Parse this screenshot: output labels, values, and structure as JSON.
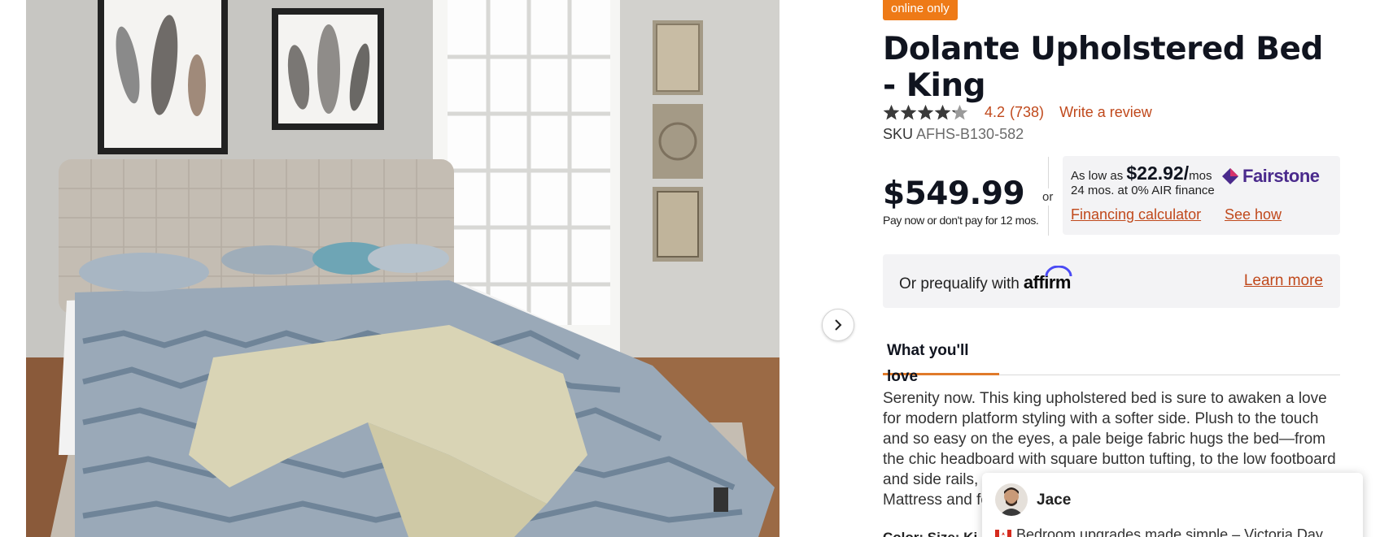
{
  "product": {
    "badge": "online only",
    "title": "Dolante Upholstered Bed - King",
    "rating_value": 4.2,
    "rating_label": "4.2",
    "rating_count": "(738)",
    "write_review": "Write a review",
    "sku_label": "SKU",
    "sku_value": "AFHS-B130-582",
    "image_alt": "Dolante Upholstered Bed - King"
  },
  "pricing": {
    "price": "$549.99",
    "pay_later": "Pay now or don't pay for 12 mos.",
    "or": "or",
    "as_low_as": "As low as",
    "monthly_amount": "$22.92/",
    "mos": "mos",
    "finance_terms": "24 mos. at 0% AIR finance",
    "fairstone_brand": "Fairstone",
    "financing_calculator": "Financing calculator",
    "see_how": "See how"
  },
  "affirm": {
    "prefix": "Or prequalify with",
    "brand": "affirm",
    "learn_more": "Learn more"
  },
  "tabs": [
    {
      "label": "What you'll love",
      "active": true
    }
  ],
  "description": "Serenity now. This king upholstered bed is sure to awaken a love for modern platform styling with a softer side. Plush to the touch and so easy on the eyes, a pale beige fabric hugs the bed—from the chic headboard with square button tufting, to the low footboard and side rails, emanatin",
  "description_tail": "Mattress and fo",
  "next_subtitle": "Color: Size: Ki",
  "chat": {
    "name": "Jace",
    "message": "Bedroom upgrades made simple – Victoria Day"
  },
  "colors": {
    "accent": "#c0491c",
    "badge": "#ee7a17",
    "tab_underline": "#e07a2a",
    "fairstone": "#4a2a8c"
  },
  "icons": {
    "next": "chevron-right-icon",
    "star": "star-icon",
    "affirm_arc": "affirm-arc-icon",
    "fairstone": "fairstone-diamond-icon",
    "flag": "canada-flag-icon"
  }
}
